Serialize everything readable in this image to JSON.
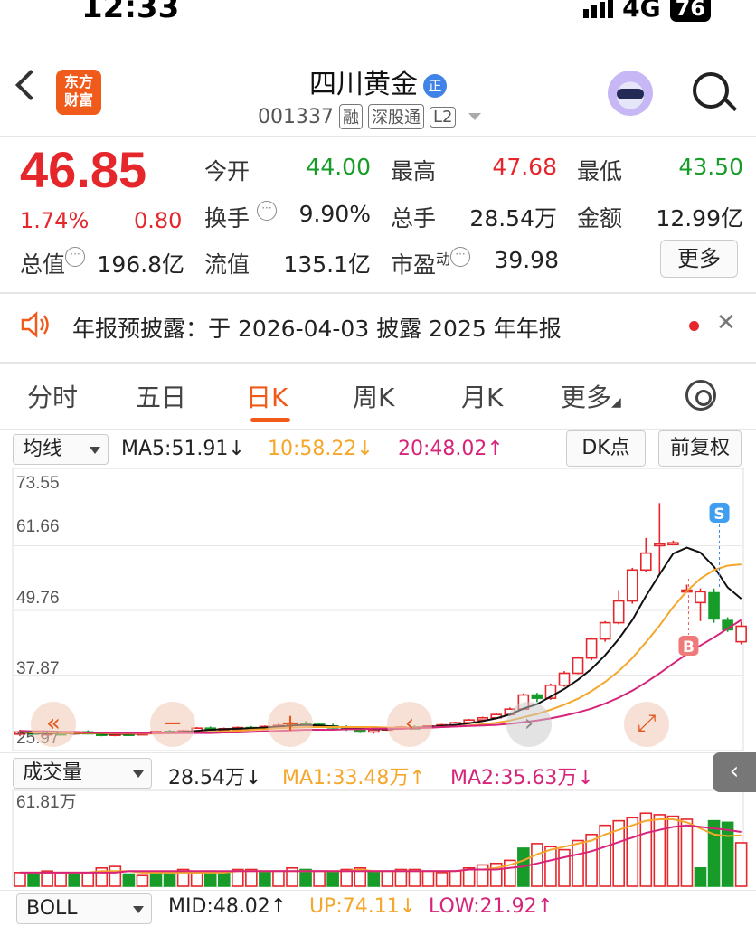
{
  "status": {
    "time": "12:33",
    "network": "4G",
    "battery": "76"
  },
  "header": {
    "logo_line1": "东方",
    "logo_line2": "财富",
    "title": "四川黄金",
    "title_badge": "正",
    "code": "001337",
    "tags": [
      "融",
      "深股通",
      "L2"
    ]
  },
  "quote": {
    "price": "46.85",
    "change_pct": "1.74%",
    "change_amt": "0.80",
    "fields": [
      {
        "label": "今开",
        "value": "44.00",
        "color": "green"
      },
      {
        "label": "最高",
        "value": "47.68",
        "color": "red"
      },
      {
        "label": "最低",
        "value": "43.50",
        "color": "green"
      },
      {
        "label": "换手",
        "value": "9.90%",
        "color": "dark"
      },
      {
        "label": "总手",
        "value": "28.54万",
        "color": "dark"
      },
      {
        "label": "金额",
        "value": "12.99亿",
        "color": "dark"
      },
      {
        "label": "流值",
        "value": "135.1亿",
        "color": "dark"
      },
      {
        "label": "市盈",
        "value": "39.98",
        "color": "dark"
      }
    ],
    "total_value_label": "总值",
    "total_value": "196.8亿",
    "pe_superscript": "动",
    "more_label": "更多"
  },
  "notice": {
    "text": "年报预披露：于 2026-04-03 披露 2025 年年报",
    "close": "✕"
  },
  "tabs": [
    {
      "label": "分时",
      "active": false
    },
    {
      "label": "五日",
      "active": false
    },
    {
      "label": "日K",
      "active": true
    },
    {
      "label": "周K",
      "active": false
    },
    {
      "label": "月K",
      "active": false
    },
    {
      "label": "更多",
      "active": false
    }
  ],
  "ma_row": {
    "selector": "均线",
    "ma5": "MA5:51.91↓",
    "ma10": "10:58.22↓",
    "ma20": "20:48.02↑",
    "dk_button": "DK点",
    "adjust_button": "前复权"
  },
  "volume_row": {
    "selector": "成交量",
    "value": "28.54万↓",
    "ma1": "MA1:33.48万↑",
    "ma2": "MA2:35.63万↓"
  },
  "boll_row": {
    "selector": "BOLL",
    "mid": "MID:48.02↑",
    "up": "UP:74.11↓",
    "low": "LOW:21.92↑"
  },
  "colors": {
    "up": "#e5262b",
    "down": "#179c2a",
    "accent": "#f05a1a",
    "ma5": "#111111",
    "ma10": "#f4a72a",
    "ma20": "#d6247a"
  },
  "chart_data": [
    {
      "type": "candlestick",
      "title": "日K",
      "ylim": [
        25.97,
        73.55
      ],
      "y_ticks": [
        "73.55",
        "61.66",
        "49.76",
        "37.87",
        "25.97"
      ],
      "markers": {
        "buy": "B",
        "sell": "S"
      },
      "candles": [
        {
          "o": 27.0,
          "h": 27.8,
          "l": 26.6,
          "c": 27.4
        },
        {
          "o": 27.4,
          "h": 27.6,
          "l": 26.8,
          "c": 27.0
        },
        {
          "o": 27.0,
          "h": 27.5,
          "l": 26.7,
          "c": 27.2
        },
        {
          "o": 27.2,
          "h": 27.6,
          "l": 26.9,
          "c": 27.1
        },
        {
          "o": 27.1,
          "h": 27.6,
          "l": 26.9,
          "c": 27.4
        },
        {
          "o": 27.4,
          "h": 27.7,
          "l": 27.0,
          "c": 27.1
        },
        {
          "o": 27.1,
          "h": 27.4,
          "l": 26.6,
          "c": 26.8
        },
        {
          "o": 26.8,
          "h": 27.3,
          "l": 26.6,
          "c": 27.1
        },
        {
          "o": 27.1,
          "h": 27.3,
          "l": 26.8,
          "c": 27.0
        },
        {
          "o": 27.0,
          "h": 27.4,
          "l": 26.8,
          "c": 27.2
        },
        {
          "o": 27.2,
          "h": 27.6,
          "l": 27.0,
          "c": 27.5
        },
        {
          "o": 27.5,
          "h": 27.8,
          "l": 27.1,
          "c": 27.3
        },
        {
          "o": 27.3,
          "h": 27.8,
          "l": 27.1,
          "c": 27.6
        },
        {
          "o": 27.6,
          "h": 28.3,
          "l": 27.4,
          "c": 28.1
        },
        {
          "o": 28.1,
          "h": 28.4,
          "l": 27.6,
          "c": 27.8
        },
        {
          "o": 27.8,
          "h": 28.2,
          "l": 27.5,
          "c": 28.0
        },
        {
          "o": 28.0,
          "h": 28.4,
          "l": 27.7,
          "c": 28.2
        },
        {
          "o": 28.2,
          "h": 28.5,
          "l": 27.8,
          "c": 28.0
        },
        {
          "o": 28.0,
          "h": 28.6,
          "l": 27.8,
          "c": 28.4
        },
        {
          "o": 28.4,
          "h": 29.0,
          "l": 28.1,
          "c": 28.6
        },
        {
          "o": 28.6,
          "h": 29.2,
          "l": 28.3,
          "c": 29.0
        },
        {
          "o": 29.0,
          "h": 29.4,
          "l": 28.6,
          "c": 28.8
        },
        {
          "o": 28.8,
          "h": 29.1,
          "l": 28.2,
          "c": 28.5
        },
        {
          "o": 28.5,
          "h": 28.9,
          "l": 28.0,
          "c": 28.3
        },
        {
          "o": 28.3,
          "h": 28.6,
          "l": 27.6,
          "c": 27.9
        },
        {
          "o": 27.9,
          "h": 28.2,
          "l": 27.2,
          "c": 27.4
        },
        {
          "o": 27.4,
          "h": 28.0,
          "l": 27.1,
          "c": 27.8
        },
        {
          "o": 27.8,
          "h": 28.3,
          "l": 27.6,
          "c": 28.1
        },
        {
          "o": 28.1,
          "h": 28.5,
          "l": 27.9,
          "c": 28.3
        },
        {
          "o": 28.3,
          "h": 28.6,
          "l": 28.0,
          "c": 28.2
        },
        {
          "o": 28.2,
          "h": 28.6,
          "l": 28.0,
          "c": 28.5
        },
        {
          "o": 28.5,
          "h": 28.9,
          "l": 28.2,
          "c": 28.7
        },
        {
          "o": 28.7,
          "h": 29.3,
          "l": 28.5,
          "c": 29.1
        },
        {
          "o": 29.1,
          "h": 29.8,
          "l": 28.9,
          "c": 29.6
        },
        {
          "o": 29.6,
          "h": 30.2,
          "l": 29.3,
          "c": 30.0
        },
        {
          "o": 30.0,
          "h": 30.8,
          "l": 29.8,
          "c": 30.6
        },
        {
          "o": 30.6,
          "h": 31.9,
          "l": 30.3,
          "c": 31.6
        },
        {
          "o": 31.6,
          "h": 34.5,
          "l": 31.4,
          "c": 34.2
        },
        {
          "o": 34.2,
          "h": 34.6,
          "l": 32.9,
          "c": 33.6
        },
        {
          "o": 33.6,
          "h": 36.3,
          "l": 33.3,
          "c": 36.0
        },
        {
          "o": 36.0,
          "h": 38.6,
          "l": 35.7,
          "c": 38.2
        },
        {
          "o": 38.2,
          "h": 41.3,
          "l": 38.0,
          "c": 41.0
        },
        {
          "o": 41.0,
          "h": 44.8,
          "l": 40.6,
          "c": 44.5
        },
        {
          "o": 44.5,
          "h": 47.8,
          "l": 44.0,
          "c": 47.5
        },
        {
          "o": 47.5,
          "h": 53.5,
          "l": 47.2,
          "c": 51.5
        },
        {
          "o": 51.5,
          "h": 57.6,
          "l": 51.0,
          "c": 57.2
        },
        {
          "o": 57.2,
          "h": 63.1,
          "l": 56.8,
          "c": 60.3
        },
        {
          "o": 62.0,
          "h": 69.5,
          "l": 56.2,
          "c": 62.0
        },
        {
          "o": 62.2,
          "h": 62.6,
          "l": 61.8,
          "c": 62.2
        },
        {
          "o": 53.5,
          "h": 54.5,
          "l": 53.0,
          "c": 53.5
        },
        {
          "o": 51.2,
          "h": 53.8,
          "l": 47.8,
          "c": 53.2
        },
        {
          "o": 53.0,
          "h": 53.8,
          "l": 47.5,
          "c": 48.2
        },
        {
          "o": 47.9,
          "h": 48.5,
          "l": 45.8,
          "c": 46.2
        },
        {
          "o": 44.0,
          "h": 47.7,
          "l": 43.5,
          "c": 46.85
        }
      ],
      "ma5": [
        27.3,
        27.2,
        27.1,
        27.2,
        27.1,
        27.2,
        27.1,
        27.0,
        27.0,
        27.1,
        27.2,
        27.3,
        27.4,
        27.6,
        27.8,
        27.9,
        28.0,
        28.1,
        28.2,
        28.4,
        28.6,
        28.7,
        28.6,
        28.4,
        28.2,
        28.0,
        27.9,
        27.9,
        28.0,
        28.2,
        28.3,
        28.5,
        28.7,
        29.0,
        29.4,
        29.9,
        30.6,
        31.7,
        32.5,
        33.9,
        35.3,
        37.0,
        39.0,
        41.5,
        44.5,
        48.0,
        52.4,
        56.4,
        60.2,
        61.3,
        60.4,
        57.8,
        54.0,
        51.91
      ],
      "ma10": [
        27.4,
        27.3,
        27.3,
        27.2,
        27.2,
        27.2,
        27.2,
        27.1,
        27.1,
        27.1,
        27.1,
        27.2,
        27.2,
        27.3,
        27.4,
        27.5,
        27.6,
        27.8,
        27.9,
        28.1,
        28.2,
        28.3,
        28.3,
        28.3,
        28.3,
        28.3,
        28.3,
        28.2,
        28.2,
        28.2,
        28.2,
        28.3,
        28.4,
        28.6,
        28.8,
        29.1,
        29.5,
        30.1,
        30.7,
        31.5,
        32.4,
        33.5,
        34.9,
        36.6,
        38.6,
        41.0,
        43.9,
        47.0,
        50.4,
        53.3,
        55.6,
        57.2,
        58.0,
        58.22
      ],
      "ma20": [
        27.6,
        27.5,
        27.5,
        27.4,
        27.4,
        27.3,
        27.3,
        27.2,
        27.2,
        27.2,
        27.2,
        27.2,
        27.2,
        27.2,
        27.2,
        27.3,
        27.3,
        27.4,
        27.5,
        27.6,
        27.7,
        27.8,
        27.8,
        27.8,
        27.9,
        27.9,
        28.0,
        28.0,
        28.0,
        28.1,
        28.2,
        28.3,
        28.4,
        28.5,
        28.6,
        28.7,
        28.9,
        29.2,
        29.5,
        29.9,
        30.4,
        31.0,
        31.7,
        32.6,
        33.7,
        35.0,
        36.5,
        38.2,
        40.0,
        41.7,
        43.3,
        44.8,
        46.4,
        48.02
      ]
    },
    {
      "type": "bar",
      "title": "成交量",
      "ylim": [
        0,
        61.81
      ],
      "y_ticks": [
        "61.81万"
      ],
      "values": [
        9,
        8,
        10,
        9,
        8,
        9,
        12,
        13,
        8,
        7,
        9,
        8,
        11,
        9,
        10,
        9,
        11,
        11,
        9,
        10,
        12,
        11,
        10,
        9,
        11,
        12,
        9,
        10,
        11,
        11,
        10,
        9,
        10,
        12,
        14,
        15,
        17,
        25,
        28,
        26,
        24,
        30,
        34,
        40,
        43,
        45,
        48,
        47,
        46,
        44,
        12,
        43,
        42,
        28.54
      ],
      "up": [
        1,
        0,
        1,
        1,
        0,
        1,
        1,
        1,
        0,
        1,
        0,
        0,
        1,
        1,
        0,
        0,
        1,
        1,
        0,
        1,
        1,
        0,
        1,
        0,
        1,
        1,
        0,
        1,
        1,
        1,
        1,
        1,
        1,
        1,
        1,
        1,
        1,
        0,
        1,
        1,
        1,
        1,
        1,
        1,
        1,
        1,
        1,
        1,
        1,
        1,
        0,
        0,
        0,
        1
      ],
      "ma1": [
        9,
        9,
        9,
        9,
        9,
        9,
        10,
        10,
        10,
        9,
        9,
        9,
        9,
        9,
        9,
        9,
        10,
        10,
        10,
        10,
        10,
        10,
        10,
        10,
        10,
        11,
        10,
        10,
        10,
        10,
        10,
        10,
        10,
        11,
        11,
        12,
        14,
        17,
        21,
        24,
        26,
        28,
        30,
        34,
        37,
        40,
        43,
        44,
        44,
        42,
        38,
        34,
        33,
        33.48
      ],
      "ma2": [
        9,
        9,
        9,
        9,
        9,
        9,
        9,
        9,
        10,
        10,
        10,
        10,
        10,
        10,
        10,
        10,
        10,
        10,
        10,
        10,
        10,
        10,
        10,
        10,
        10,
        10,
        10,
        10,
        10,
        10,
        10,
        10,
        10,
        11,
        11,
        11,
        12,
        13,
        15,
        17,
        19,
        21,
        23,
        26,
        29,
        32,
        35,
        37,
        39,
        40,
        39,
        38,
        37,
        35.63
      ]
    }
  ]
}
